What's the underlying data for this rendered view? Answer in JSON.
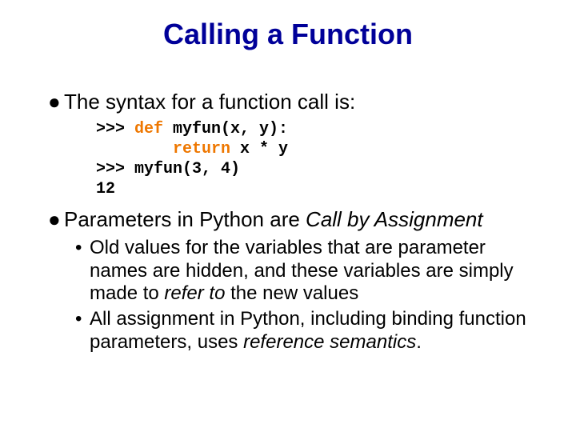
{
  "title": "Calling a Function",
  "bullets": {
    "b1": "The syntax for a function call is:",
    "b2_pre": "Parameters in Python are ",
    "b2_em": "Call by Assignment"
  },
  "code": {
    "p1": ">>> ",
    "kw_def": "def",
    "sig": " myfun(x, y):",
    "indent": "        ",
    "kw_return": "return",
    "expr": " x * y",
    "p2": ">>> myfun(3, 4)",
    "out": "12"
  },
  "sub": {
    "s1_a": "Old values for the variables that are parameter names are hidden, and these variables are simply made to ",
    "s1_em": "refer to",
    "s1_b": " the new values",
    "s2_a": "All assignment in Python, including binding function parameters, uses ",
    "s2_em": "reference semantics",
    "s2_b": "."
  }
}
